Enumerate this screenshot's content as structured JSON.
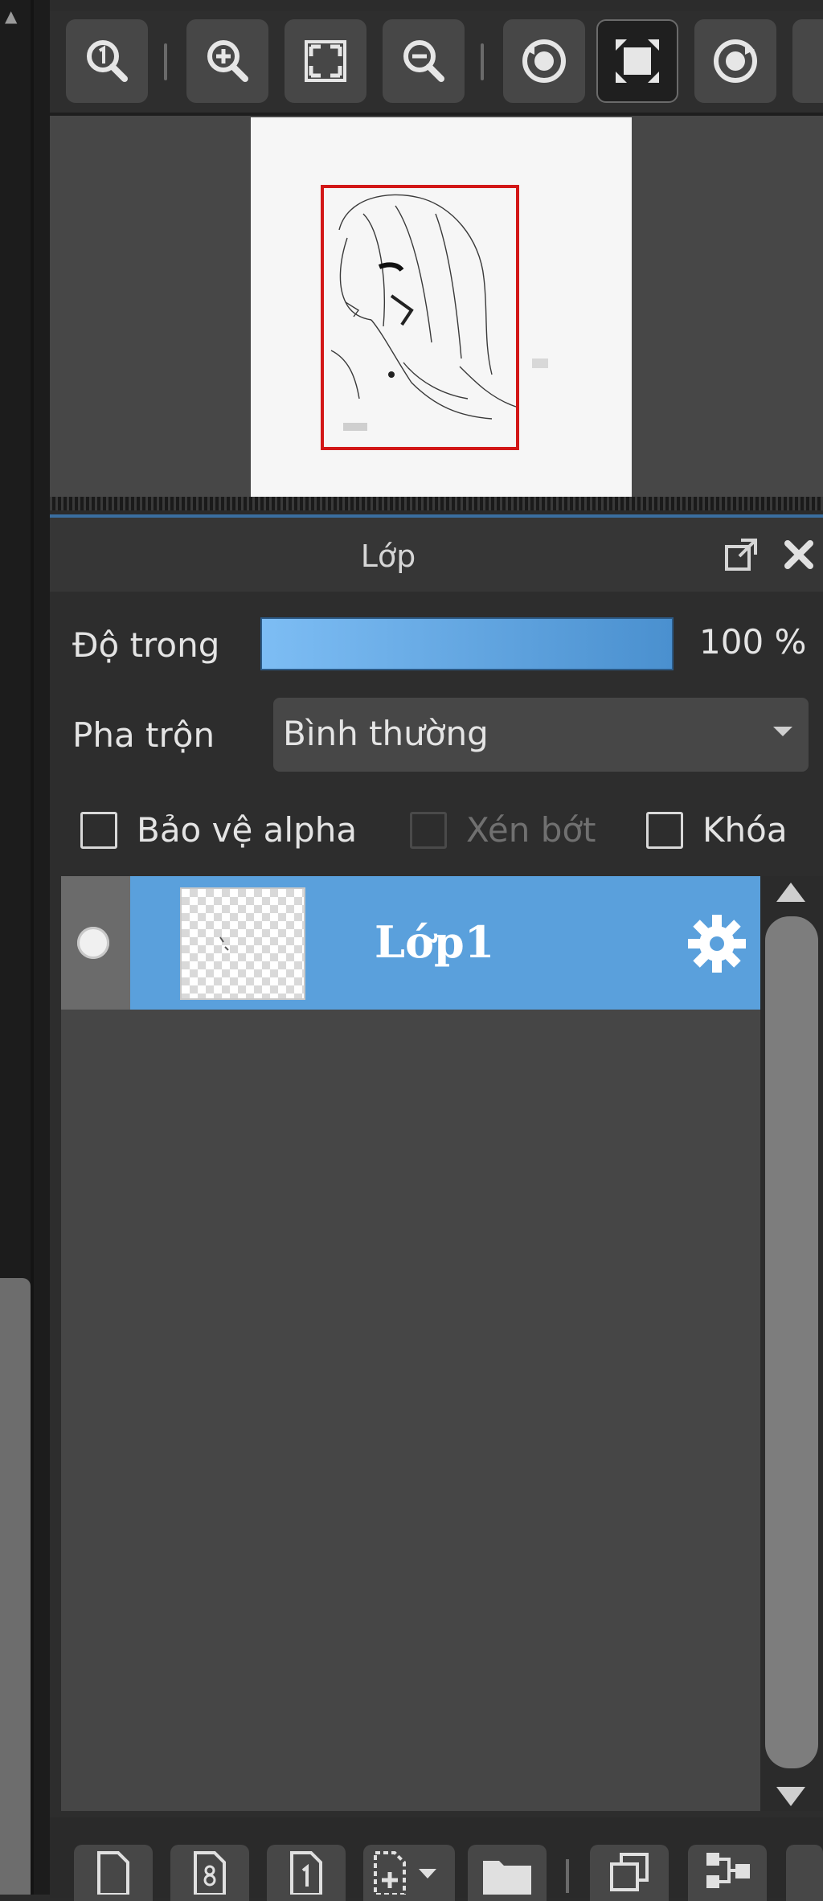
{
  "navigator": {
    "toolbar": {
      "buttons": [
        {
          "name": "zoom-actual-size",
          "icon": "zoom-1-to-1-icon"
        },
        {
          "name": "zoom-in",
          "icon": "zoom-in-icon"
        },
        {
          "name": "fit-to-window",
          "icon": "fit-screen-icon"
        },
        {
          "name": "zoom-out",
          "icon": "zoom-out-icon"
        },
        {
          "name": "rotate-left",
          "icon": "rotate-left-icon"
        },
        {
          "name": "fullscreen",
          "icon": "fullscreen-icon",
          "active": true
        },
        {
          "name": "rotate-right",
          "icon": "rotate-right-icon"
        }
      ]
    },
    "preview": {
      "frame_color": "#d21717",
      "paper_color": "#f6f6f6"
    }
  },
  "layer_panel": {
    "title": "Lớp",
    "opacity": {
      "label": "Độ trong",
      "value": "100 %",
      "level": 1.0
    },
    "blend": {
      "label": "Pha trộn",
      "selected": "Bình thường"
    },
    "checkboxes": [
      {
        "label": "Bảo vệ alpha",
        "checked": false,
        "enabled": true
      },
      {
        "label": "Xén bớt",
        "checked": false,
        "enabled": false
      },
      {
        "label": "Khóa",
        "checked": false,
        "enabled": true
      }
    ],
    "layers": [
      {
        "name": "Lớp1",
        "selected": true,
        "visible": true
      }
    ],
    "bottom_toolbar": {
      "buttons": [
        {
          "name": "new-layer",
          "icon": "new-page-icon"
        },
        {
          "name": "new-8bit-layer",
          "icon": "layer-8-icon"
        },
        {
          "name": "new-1bit-layer",
          "icon": "layer-1-icon"
        },
        {
          "name": "add-layer-menu",
          "icon": "add-layer-dropdown-icon"
        },
        {
          "name": "new-folder",
          "icon": "folder-icon"
        },
        {
          "name": "duplicate-layer",
          "icon": "duplicate-icon"
        },
        {
          "name": "merge-down",
          "icon": "merge-icon"
        }
      ]
    }
  },
  "colors": {
    "accent": "#5aa0dc",
    "panel_bg": "#2d2d2d",
    "list_bg": "#464646"
  }
}
